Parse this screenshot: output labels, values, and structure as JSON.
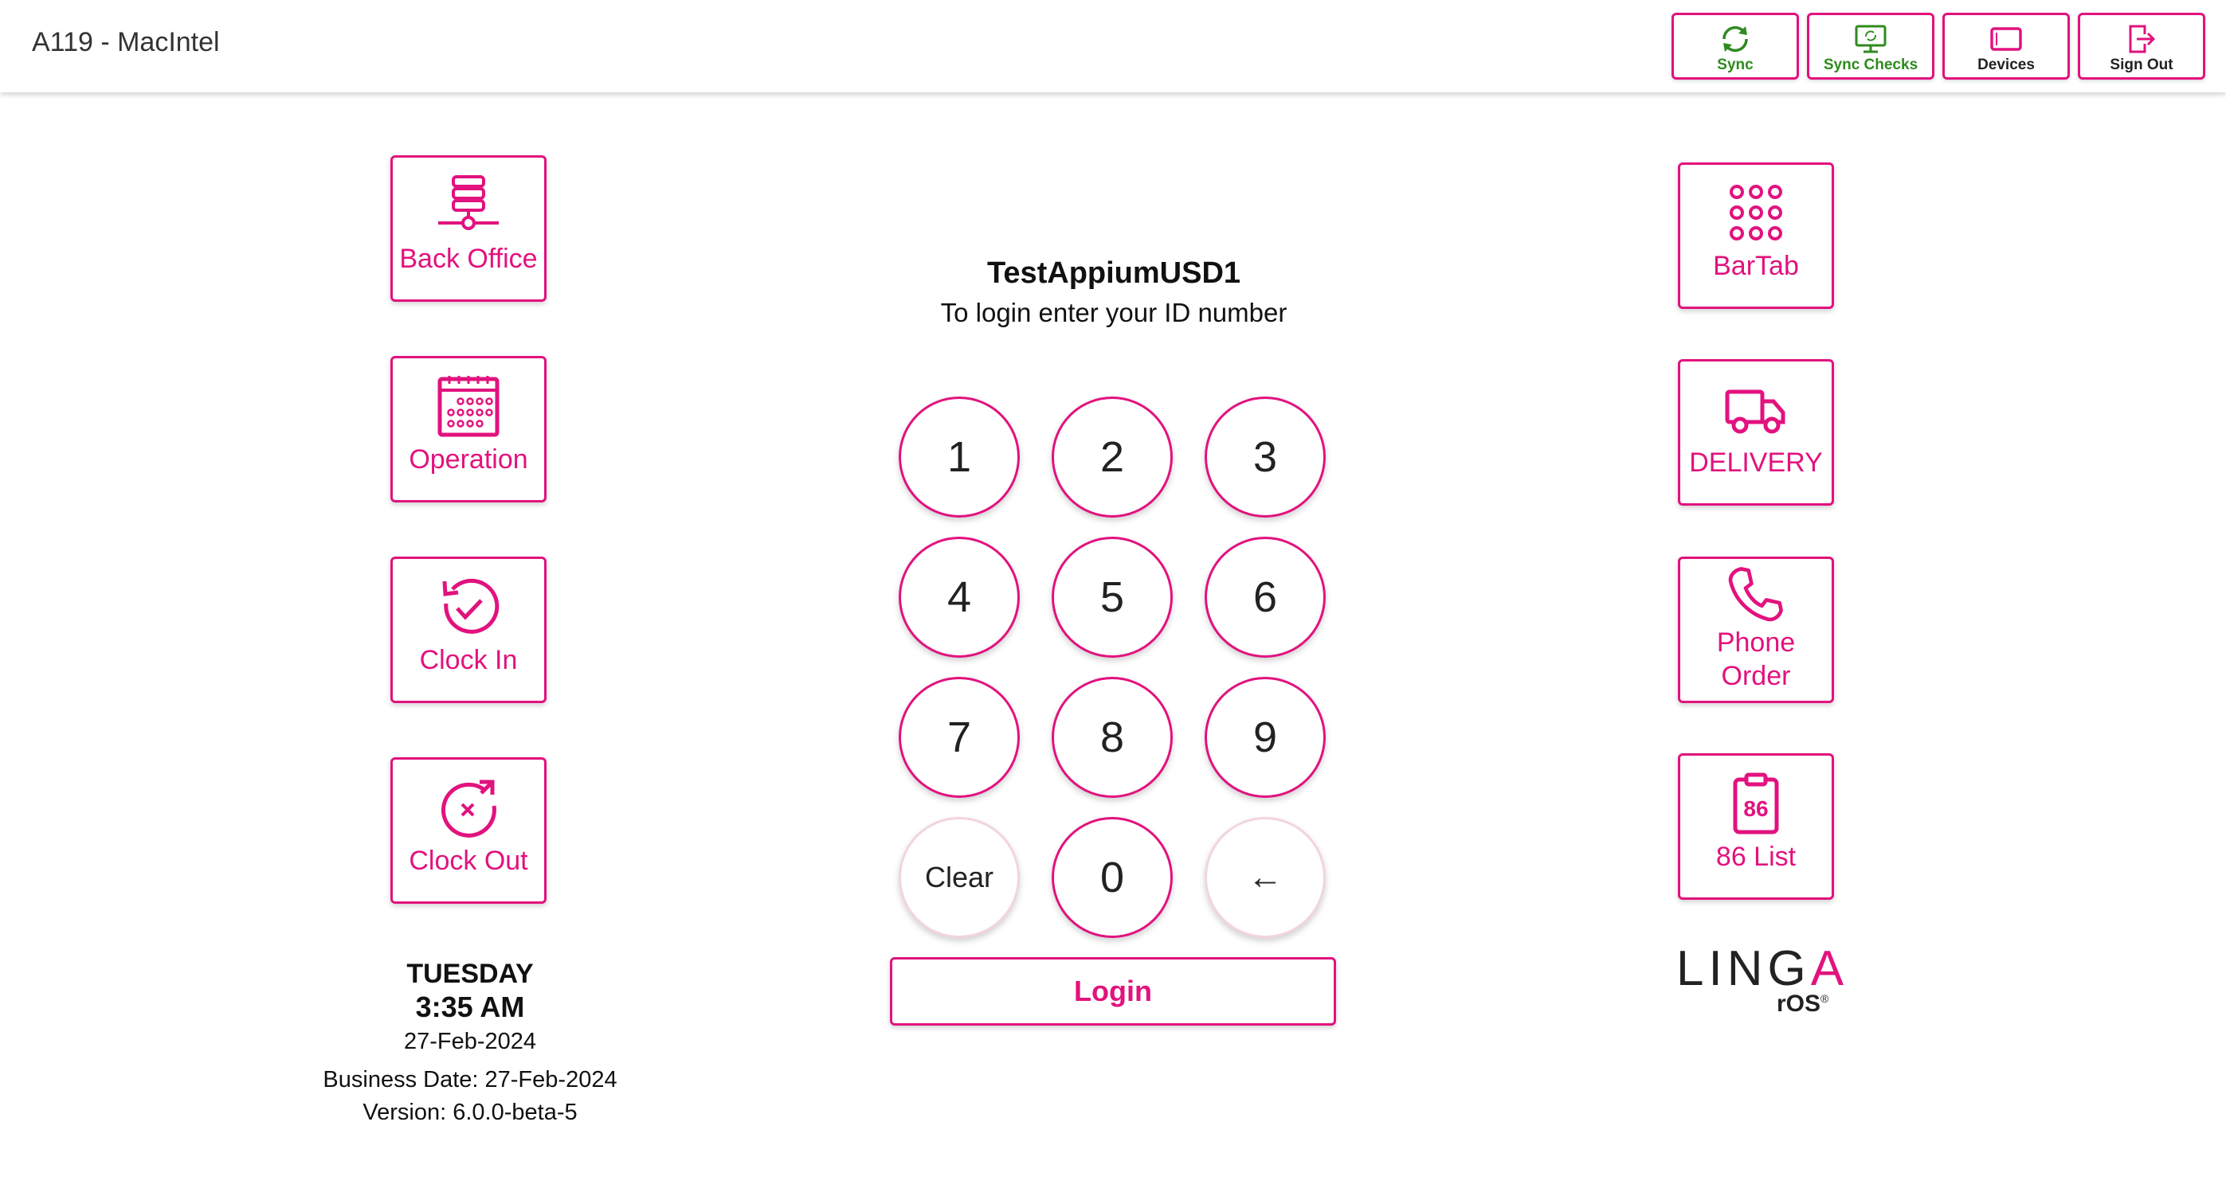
{
  "header": {
    "device_title": "A119 - MacIntel",
    "buttons": [
      {
        "label": "Sync",
        "icon": "sync-icon"
      },
      {
        "label": "Sync Checks",
        "icon": "monitor-sync-icon"
      },
      {
        "label": "Devices",
        "icon": "tablet-icon"
      },
      {
        "label": "Sign Out",
        "icon": "sign-out-icon"
      }
    ]
  },
  "left_tiles": [
    {
      "label": "Back Office",
      "icon": "server-network-icon"
    },
    {
      "label": "Operation",
      "icon": "calendar-icon"
    },
    {
      "label": "Clock In",
      "icon": "clock-in-check-icon"
    },
    {
      "label": "Clock Out",
      "icon": "clock-out-x-icon"
    }
  ],
  "right_tiles": [
    {
      "label": "BarTab",
      "icon": "dots-grid-icon"
    },
    {
      "label": "DELIVERY",
      "icon": "delivery-truck-icon"
    },
    {
      "label": "Phone",
      "label2": "Order",
      "icon": "phone-icon"
    },
    {
      "label": "86 List",
      "icon": "clipboard-86-icon",
      "badge": "86"
    }
  ],
  "login": {
    "store_name": "TestAppiumUSD1",
    "instruction": "To login enter your ID number",
    "keys": [
      "1",
      "2",
      "3",
      "4",
      "5",
      "6",
      "7",
      "8",
      "9",
      "Clear",
      "0",
      "←"
    ],
    "button_label": "Login"
  },
  "info": {
    "day": "TUESDAY",
    "time": "3:35 AM",
    "date": "27-Feb-2024",
    "business_date": "Business Date: 27-Feb-2024",
    "version": "Version: 6.0.0-beta-5"
  },
  "logo": {
    "text_main_a": "LING",
    "text_main_b": "A",
    "text_sub": "rOS",
    "registered": "®"
  },
  "colors": {
    "accent": "#e2127e",
    "sync_green": "#2e8b1e",
    "text": "#222222"
  }
}
